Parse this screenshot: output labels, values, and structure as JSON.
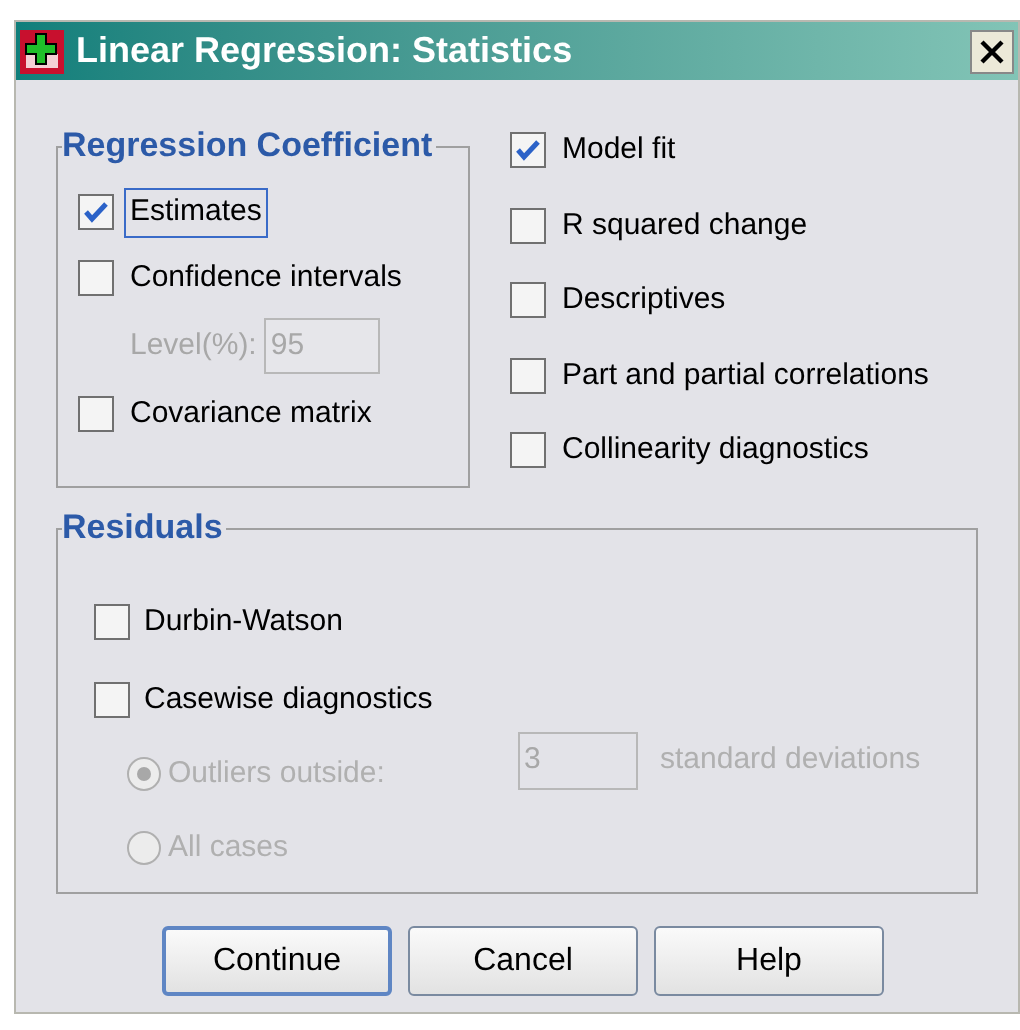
{
  "window": {
    "title": "Linear Regression: Statistics"
  },
  "regression_coefficient": {
    "title": "Regression Coefficient",
    "items": [
      {
        "kind": "checkbox",
        "label": "Estimates",
        "checked": true,
        "focused": true
      },
      {
        "kind": "checkbox",
        "label": "Confidence intervals",
        "checked": false,
        "focused": false
      },
      {
        "kind": "field",
        "label": "Level(%):",
        "value": "95",
        "disabled": true
      },
      {
        "kind": "checkbox",
        "label": "Covariance matrix",
        "checked": false,
        "focused": false
      }
    ]
  },
  "options": [
    {
      "label": "Model fit",
      "checked": true
    },
    {
      "label": "R squared change",
      "checked": false
    },
    {
      "label": "Descriptives",
      "checked": false
    },
    {
      "label": "Part and partial correlations",
      "checked": false
    },
    {
      "label": "Collinearity diagnostics",
      "checked": false
    }
  ],
  "residuals": {
    "title": "Residuals",
    "checkboxes": [
      {
        "label": "Durbin-Watson",
        "checked": false
      },
      {
        "label": "Casewise diagnostics",
        "checked": false
      }
    ],
    "radios": [
      {
        "label": "Outliers outside:",
        "selected": true,
        "disabled": true,
        "field_value": "3",
        "suffix": "standard deviations"
      },
      {
        "label": "All cases",
        "selected": false,
        "disabled": true
      }
    ]
  },
  "buttons": [
    {
      "label": "Continue",
      "default": true
    },
    {
      "label": "Cancel",
      "default": false
    },
    {
      "label": "Help",
      "default": false
    }
  ]
}
